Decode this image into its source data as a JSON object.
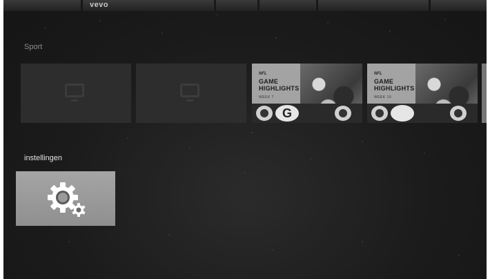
{
  "top_row": {
    "tiles": [
      {
        "text": ""
      },
      {
        "text": "vevo"
      },
      {
        "text": ""
      },
      {
        "text": ""
      },
      {
        "text": ""
      },
      {
        "text": ""
      }
    ]
  },
  "sport_row": {
    "title": "Sport",
    "tiles": [
      {
        "kind": "placeholder",
        "icon": "tv-icon"
      },
      {
        "kind": "placeholder",
        "icon": "tv-icon"
      },
      {
        "kind": "highlight",
        "brand": "NFL",
        "title_line1": "GAME",
        "title_line2": "HIGHLIGHTS",
        "week": "WEEK 7",
        "logo_mid": "G"
      },
      {
        "kind": "highlight",
        "brand": "NFL",
        "title_line1": "GAME",
        "title_line2": "HIGHLIGHTS",
        "week": "WEEK 10",
        "logo_mid": ""
      }
    ]
  },
  "settings_row": {
    "title": "instellingen",
    "card_icon": "settings-gear-icon"
  }
}
